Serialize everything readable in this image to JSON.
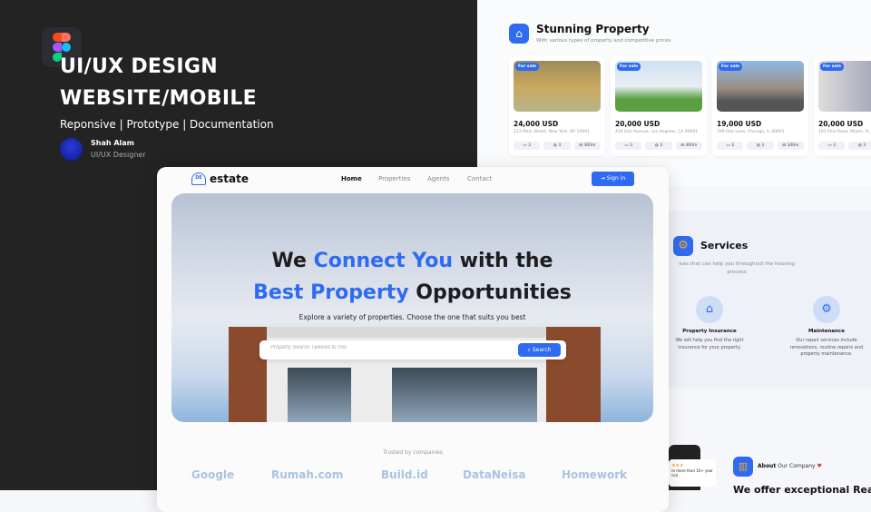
{
  "showcase": {
    "title_line1": "UI/UX DESIGN",
    "title_line2": "WEBSITE/MOBILE",
    "subtitle": "Reponsive | Prototype | Documentation",
    "author": "Shah Alam",
    "role": "UI/UX Designer"
  },
  "property": {
    "title": "Stunning Property",
    "subtitle": "With various types of property and competitive prices",
    "cards": [
      {
        "tag": "For sale",
        "price": "24,000 USD",
        "address": "123 Main Street, New York, NY 10001",
        "beds": "3",
        "baths": "3",
        "area": "360m"
      },
      {
        "tag": "For sale",
        "price": "20,000 USD",
        "address": "456 Elm Avenue, Los Angeles, CA 90001",
        "beds": "3",
        "baths": "3",
        "area": "460m"
      },
      {
        "tag": "For sale",
        "price": "19,000 USD",
        "address": "789 Oak Lane, Chicago, IL 60601",
        "beds": "3",
        "baths": "3",
        "area": "340m"
      },
      {
        "tag": "For sale",
        "price": "20,000 USD",
        "address": "101 Pine Road, Miami, FL",
        "beds": "3",
        "baths": "3",
        "area": ""
      }
    ]
  },
  "services": {
    "title": "Services",
    "subtitle": "ices that can help you throughout the housing process",
    "items": [
      {
        "title": "Property Insurance",
        "desc": "We will help you find the right insurance for your property."
      },
      {
        "title": "Maintenance",
        "desc": "Our repair services include renovations, routine repairs and property maintenance."
      }
    ]
  },
  "about": {
    "bold": "About",
    "rest": " Our Company",
    "headline": "We offer exceptional Real",
    "review_stars": "★★★",
    "review_text": "re more than 10+ year nce"
  },
  "site": {
    "logo": "estate",
    "logo_mark": "DE",
    "nav": [
      "Home",
      "Properties",
      "Agents",
      "Contact"
    ],
    "signin": "Sign in",
    "hero_pre": "We ",
    "hero_blue1": "Connect You",
    "hero_mid": " with the",
    "hero_blue2": "Best Property",
    "hero_post": " Opportunities",
    "lead": "Explore a variety of properties. Choose the one that suits you best",
    "search_placeholder": "Property Search Tailored to You",
    "search_button": "Search",
    "trusted": "Trusted by companies",
    "companies": [
      "Google",
      "Rumah.com",
      "Build.id",
      "DataNeisa",
      "Homework"
    ]
  },
  "colors": {
    "accent": "#2f6bf2",
    "dark": "#232323",
    "logos": "#a9c3df"
  }
}
